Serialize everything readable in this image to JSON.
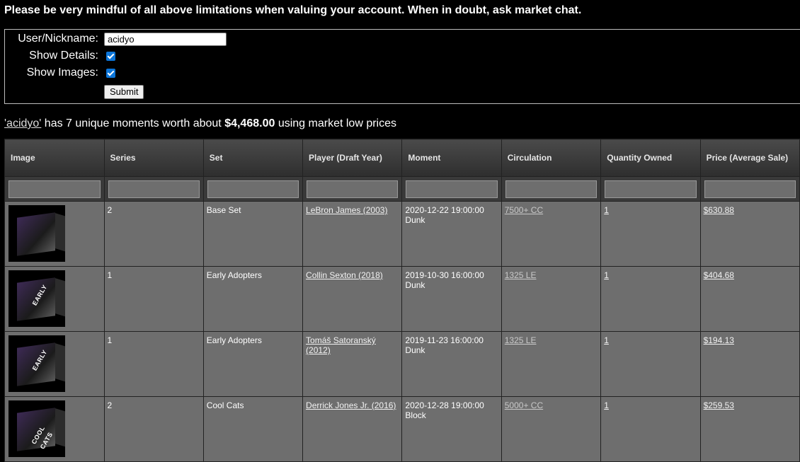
{
  "notice": "Please be very mindful of all above limitations when valuing your account. When in doubt, ask market chat.",
  "form": {
    "user_label": "User/Nickname:",
    "user_value": "acidyo",
    "details_label": "Show Details:",
    "details_checked": true,
    "images_label": "Show Images:",
    "images_checked": true,
    "submit_label": "Submit"
  },
  "summary": {
    "user_link": "'acidyo'",
    "text_mid": " has 7 unique moments worth about ",
    "total": "$4,468.00",
    "text_end": " using market low prices"
  },
  "table": {
    "headers": [
      "Image",
      "Series",
      "Set",
      "Player (Draft Year)",
      "Moment",
      "Circulation",
      "Quantity Owned",
      "Price (Average Sale)"
    ],
    "rows": [
      {
        "series": "2",
        "set": "Base Set",
        "player": "LeBron James (2003)",
        "moment_date": "2020-12-22 19:00:00",
        "moment_type": "Dunk",
        "circulation": "7500+ CC",
        "quantity": "1",
        "price": "$630.88",
        "image_label": ""
      },
      {
        "series": "1",
        "set": "Early Adopters",
        "player": "Collin Sexton (2018)",
        "moment_date": "2019-10-30 16:00:00",
        "moment_type": "Dunk",
        "circulation": "1325 LE",
        "quantity": "1",
        "price": "$404.68",
        "image_label": "EARLY"
      },
      {
        "series": "1",
        "set": "Early Adopters",
        "player": "Tomáš Satoranský (2012)",
        "moment_date": "2019-11-23 16:00:00",
        "moment_type": "Dunk",
        "circulation": "1325 LE",
        "quantity": "1",
        "price": "$194.13",
        "image_label": "EARLY"
      },
      {
        "series": "2",
        "set": "Cool Cats",
        "player": "Derrick Jones Jr. (2016)",
        "moment_date": "2020-12-28 19:00:00",
        "moment_type": "Block",
        "circulation": "5000+ CC",
        "quantity": "1",
        "price": "$259.53",
        "image_label": "COOL CATS"
      }
    ]
  },
  "colors": {
    "background": "#000000",
    "row_bg": "#6e6e6e",
    "checkbox": "#0b75d9"
  },
  "icons": {
    "checkbox_checked": "check-icon"
  }
}
